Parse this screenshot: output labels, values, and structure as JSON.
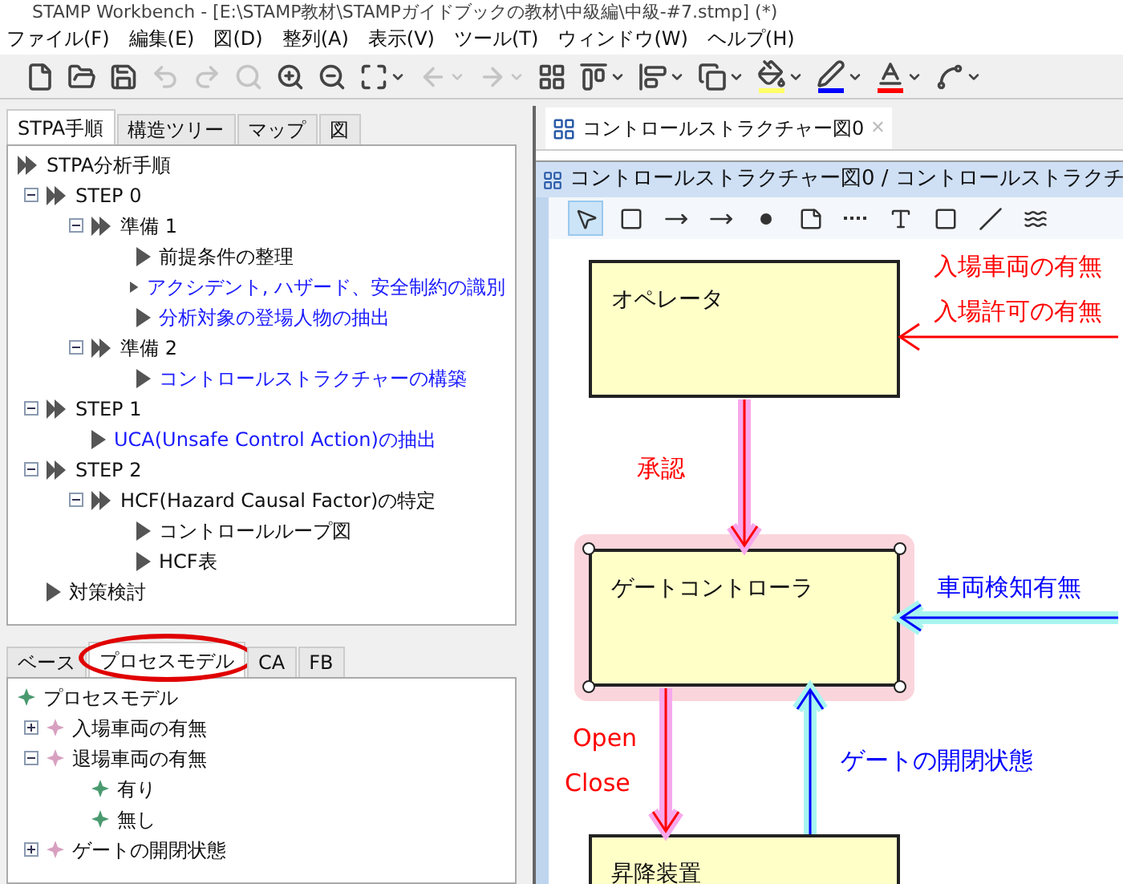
{
  "window": {
    "title": "STAMP Workbench - [E:\\STAMP教材\\STAMPガイドブックの教材\\中級編\\中級-#7.stmp] (*)"
  },
  "menu": [
    "ファイル(F)",
    "編集(E)",
    "図(D)",
    "整列(A)",
    "表示(V)",
    "ツール(T)",
    "ウィンドウ(W)",
    "ヘルプ(H)"
  ],
  "toolbar": [
    {
      "kind": "new",
      "disabled": false,
      "dropdown": false
    },
    {
      "kind": "open",
      "disabled": false,
      "dropdown": false
    },
    {
      "kind": "save",
      "disabled": false,
      "dropdown": false
    },
    {
      "kind": "undo",
      "disabled": true,
      "dropdown": false
    },
    {
      "kind": "redo",
      "disabled": true,
      "dropdown": false
    },
    {
      "kind": "find",
      "disabled": true,
      "dropdown": false
    },
    {
      "kind": "zoom-in",
      "disabled": false,
      "dropdown": false
    },
    {
      "kind": "zoom-out",
      "disabled": false,
      "dropdown": false
    },
    {
      "kind": "fit",
      "disabled": false,
      "dropdown": true
    },
    {
      "kind": "back",
      "disabled": true,
      "dropdown": true
    },
    {
      "kind": "forward",
      "disabled": true,
      "dropdown": true
    },
    {
      "kind": "layout",
      "disabled": false,
      "dropdown": false
    },
    {
      "kind": "align-top",
      "disabled": false,
      "dropdown": true
    },
    {
      "kind": "align-left",
      "disabled": false,
      "dropdown": true
    },
    {
      "kind": "arrange",
      "disabled": false,
      "dropdown": true
    },
    {
      "kind": "fill",
      "disabled": false,
      "dropdown": true,
      "color": "#ffff66"
    },
    {
      "kind": "line-color",
      "disabled": false,
      "dropdown": true,
      "color": "#0000ff"
    },
    {
      "kind": "font-color",
      "disabled": false,
      "dropdown": true,
      "color": "#ff0000"
    },
    {
      "kind": "connector",
      "disabled": false,
      "dropdown": true
    }
  ],
  "left_tabs": [
    {
      "label": "STPA手順",
      "selected": true
    },
    {
      "label": "構造ツリー",
      "selected": false
    },
    {
      "label": "マップ",
      "selected": false
    },
    {
      "label": "図",
      "selected": false
    }
  ],
  "procedure_tree": [
    {
      "label": "STPA分析手順",
      "kind": "group",
      "linked": false,
      "expanded": true,
      "children": [
        {
          "label": "STEP 0",
          "kind": "group",
          "linked": false,
          "expanded": true,
          "children": [
            {
              "label": "準備 1",
              "kind": "group",
              "linked": false,
              "expanded": true,
              "children": [
                {
                  "label": "前提条件の整理",
                  "kind": "task",
                  "linked": false
                },
                {
                  "label": "アクシデント, ハザード、安全制約の識別",
                  "kind": "task",
                  "linked": true
                },
                {
                  "label": "分析対象の登場人物の抽出",
                  "kind": "task",
                  "linked": true
                }
              ]
            },
            {
              "label": "準備 2",
              "kind": "group",
              "linked": false,
              "expanded": true,
              "children": [
                {
                  "label": "コントロールストラクチャーの構築",
                  "kind": "task",
                  "linked": true
                }
              ]
            }
          ]
        },
        {
          "label": "STEP 1",
          "kind": "group",
          "linked": false,
          "expanded": true,
          "children": [
            {
              "label": "UCA(Unsafe Control Action)の抽出",
              "kind": "task",
              "linked": true
            }
          ]
        },
        {
          "label": "STEP 2",
          "kind": "group",
          "linked": false,
          "expanded": true,
          "children": [
            {
              "label": "HCF(Hazard Causal Factor)の特定",
              "kind": "group",
              "linked": false,
              "expanded": true,
              "children": [
                {
                  "label": "コントロールループ図",
                  "kind": "task",
                  "linked": false
                },
                {
                  "label": "HCF表",
                  "kind": "task",
                  "linked": false
                }
              ]
            }
          ]
        },
        {
          "label": "対策検討",
          "kind": "task",
          "linked": false
        }
      ]
    }
  ],
  "bottom_tabs": [
    {
      "label": "ベース",
      "selected": false,
      "circled": false
    },
    {
      "label": "プロセスモデル",
      "selected": true,
      "circled": true
    },
    {
      "label": "CA",
      "selected": false,
      "circled": false
    },
    {
      "label": "FB",
      "selected": false,
      "circled": false
    }
  ],
  "process_tree": [
    {
      "label": "プロセスモデル",
      "kind": "value",
      "expanded": true,
      "children": [
        {
          "label": "入場車両の有無",
          "kind": "variable",
          "expanded": false
        },
        {
          "label": "退場車両の有無",
          "kind": "variable",
          "expanded": true,
          "children": [
            {
              "label": "有り",
              "kind": "value"
            },
            {
              "label": "無し",
              "kind": "value"
            }
          ]
        },
        {
          "label": "ゲートの開閉状態",
          "kind": "variable",
          "expanded": false
        }
      ]
    }
  ],
  "editor_tab": {
    "label": "コントロールストラクチャー図0",
    "close": "✕"
  },
  "diagram_window": {
    "title": "コントロールストラクチャー図0 / コントロールストラクチ"
  },
  "diagram_tools": [
    {
      "kind": "select",
      "selected": true
    },
    {
      "kind": "component",
      "selected": false
    },
    {
      "kind": "arrow",
      "selected": false
    },
    {
      "kind": "dotted-arrow",
      "selected": false
    },
    {
      "kind": "dot",
      "selected": false
    },
    {
      "kind": "note",
      "selected": false
    },
    {
      "kind": "dots",
      "selected": false
    },
    {
      "kind": "text",
      "selected": false
    },
    {
      "kind": "rect",
      "selected": false
    },
    {
      "kind": "line",
      "selected": false
    },
    {
      "kind": "curve",
      "selected": false
    }
  ],
  "blocks": [
    {
      "label": "オペレータ",
      "selected": false
    },
    {
      "label": "ゲートコントローラ",
      "selected": true
    },
    {
      "label": "昇降装置",
      "selected": false
    }
  ],
  "edges": [
    {
      "color": "#ff0000",
      "highlighted": false,
      "labels": [
        "入場車両の有無",
        "入場許可の有無"
      ]
    },
    {
      "color": "#ff0000",
      "highlighted": true,
      "labels": [
        "承認"
      ]
    },
    {
      "color": "#0000ff",
      "highlighted": true,
      "labels": [
        "車両検知有無"
      ]
    },
    {
      "color": "#ff0000",
      "highlighted": true,
      "labels": [
        "Open",
        "Close"
      ]
    },
    {
      "color": "#0000ff",
      "highlighted": true,
      "labels": [
        "ゲートの開閉状態"
      ]
    }
  ]
}
